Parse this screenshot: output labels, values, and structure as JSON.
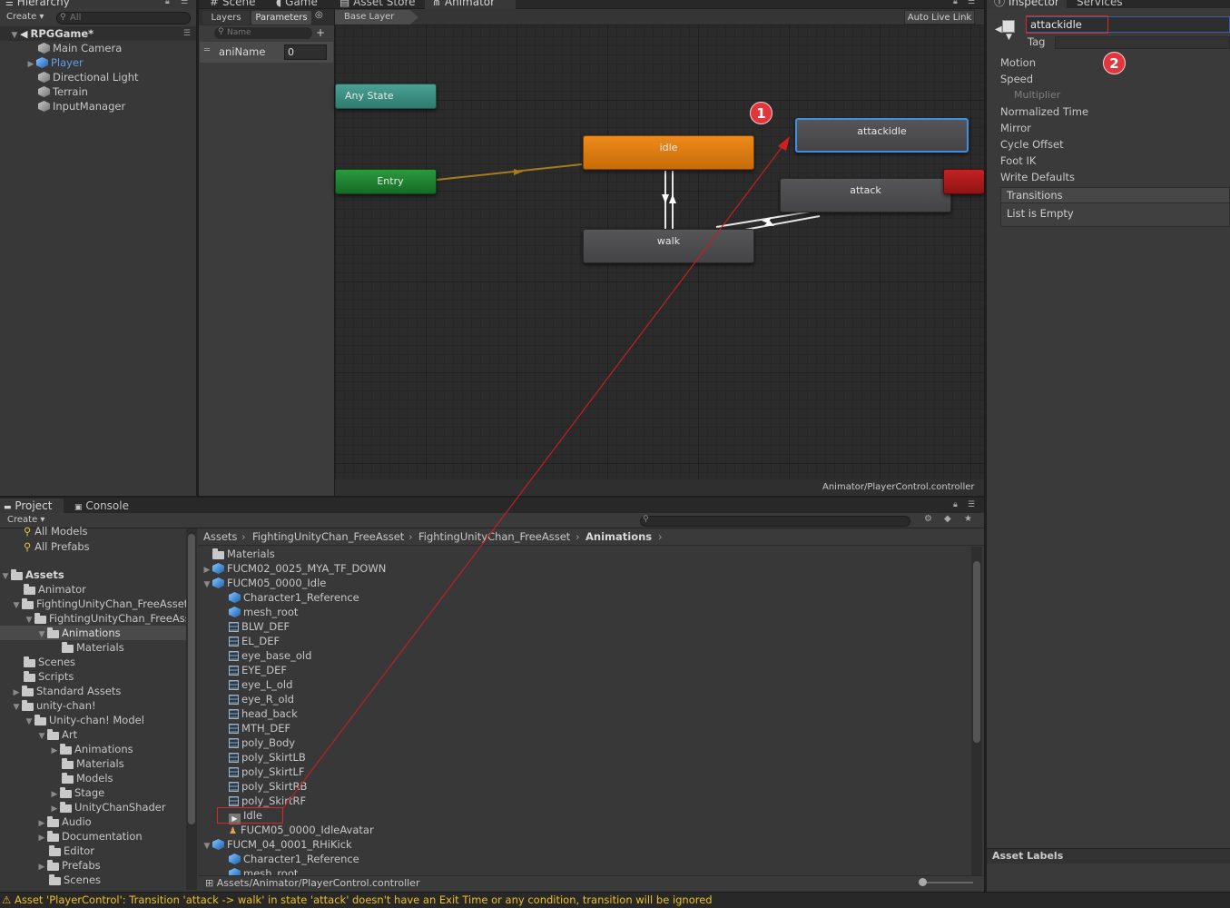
{
  "hierarchy": {
    "tab": "Hierarchy",
    "create": "Create",
    "search_placeholder": "All",
    "scene": "RPGGame*",
    "items": [
      "Main Camera",
      "Player",
      "Directional Light",
      "Terrain",
      "InputManager"
    ]
  },
  "animator": {
    "tabs": [
      "Scene",
      "Game",
      "Asset Store",
      "Animator"
    ],
    "panel_tabs": [
      "Layers",
      "Parameters"
    ],
    "param_search_placeholder": "Name",
    "param": {
      "name": "aniName",
      "value": "0"
    },
    "breadcrumb": "Base Layer",
    "auto_live_link": "Auto Live Link",
    "footer_path": "Animator/PlayerControl.controller",
    "nodes": {
      "any_state": "Any State",
      "entry": "Entry",
      "idle": "idle",
      "walk": "walk",
      "attack": "attack",
      "attackidle": "attackidle"
    }
  },
  "inspector": {
    "tabs": [
      "Inspector",
      "Services"
    ],
    "name_value": "attackidle",
    "tag_label": "Tag",
    "fields": [
      "Motion",
      "Speed",
      "Multiplier",
      "Normalized Time",
      "Mirror",
      "Cycle Offset",
      "Foot IK",
      "Write Defaults"
    ],
    "transitions_header": "Transitions",
    "transitions_empty": "List is Empty",
    "asset_labels": "Asset Labels"
  },
  "project": {
    "tabs": [
      "Project",
      "Console"
    ],
    "create": "Create",
    "favorites": [
      "All Models",
      "All Prefabs"
    ],
    "tree": [
      "Assets",
      "Animator",
      "FightingUnityChan_FreeAsset",
      "FightingUnityChan_FreeAsset",
      "Animations",
      "Materials",
      "Scenes",
      "Scripts",
      "Standard Assets",
      "unity-chan!",
      "Unity-chan! Model",
      "Art",
      "Animations",
      "Materials",
      "Models",
      "Stage",
      "UnityChanShader",
      "Audio",
      "Documentation",
      "Editor",
      "Prefabs",
      "Scenes"
    ],
    "breadcrumb": [
      "Assets",
      "FightingUnityChan_FreeAsset",
      "FightingUnityChan_FreeAsset",
      "Animations"
    ],
    "files": [
      "Materials",
      "FUCM02_0025_MYA_TF_DOWN",
      "FUCM05_0000_Idle",
      "Character1_Reference",
      "mesh_root",
      "BLW_DEF",
      "EL_DEF",
      "eye_base_old",
      "EYE_DEF",
      "eye_L_old",
      "eye_R_old",
      "head_back",
      "MTH_DEF",
      "poly_Body",
      "poly_SkirtLB",
      "poly_SkirtLF",
      "poly_SkirtRB",
      "poly_SkirtRF",
      "Idle",
      "FUCM05_0000_IdleAvatar",
      "FUCM_04_0001_RHiKick",
      "Character1_Reference",
      "mesh_root"
    ],
    "footer_path": "Assets/Animator/PlayerControl.controller"
  },
  "annotations": {
    "marker1": "1",
    "marker2": "2"
  },
  "status_bar": "Asset 'PlayerControl': Transition 'attack -> walk' in state 'attack' doesn't have an Exit Time or any condition, transition will be ignored",
  "colors": {
    "idle": "#d97a0f",
    "entry": "#1f7a2f",
    "any_state": "#3c8f82",
    "state": "#4c4c50",
    "selected_border": "#3d8fe0",
    "warning": "#f0c020"
  }
}
